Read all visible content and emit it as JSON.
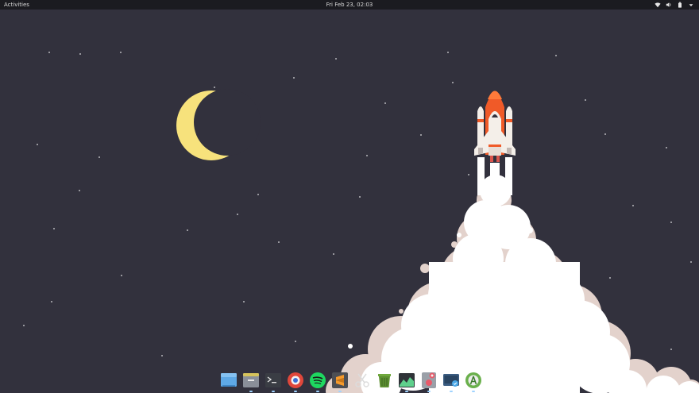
{
  "topbar": {
    "activities_label": "Activities",
    "clock": "Fri Feb 23, 02:03",
    "status_icons": [
      "network-icon",
      "volume-icon",
      "battery-icon",
      "system-menu-arrow-icon"
    ]
  },
  "wallpaper": {
    "colors": {
      "sky": "#32313d",
      "moon": "#f7e27c",
      "smoke": "#ffffff",
      "smoke_shadow": "#e3d2cc",
      "rocket_body": "#f4efe9",
      "rocket_accent": "#f05a28"
    }
  },
  "dock": {
    "items": [
      {
        "name": "files-icon",
        "running": false
      },
      {
        "name": "file-manager-icon",
        "running": true
      },
      {
        "name": "terminal-icon",
        "running": true
      },
      {
        "name": "browser-icon",
        "running": true
      },
      {
        "name": "spotify-icon",
        "running": true
      },
      {
        "name": "sublime-text-icon",
        "running": true
      },
      {
        "name": "screenshot-tool-icon",
        "running": false
      },
      {
        "name": "trash-icon",
        "running": false
      },
      {
        "name": "system-monitor-icon",
        "running": true
      },
      {
        "name": "settings-icon",
        "running": true
      },
      {
        "name": "messaging-icon",
        "running": true
      },
      {
        "name": "android-studio-icon",
        "running": true
      }
    ]
  }
}
